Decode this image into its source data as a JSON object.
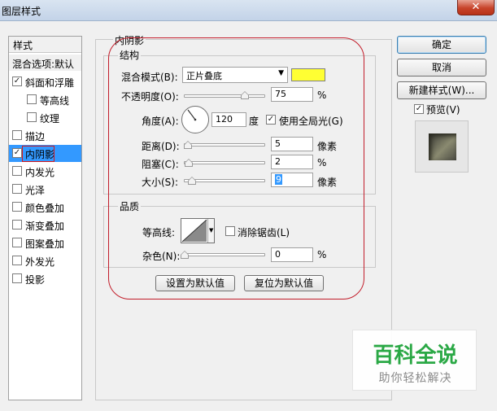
{
  "window": {
    "title": "图层样式",
    "close_glyph": "✕"
  },
  "style_list": {
    "header": "样式",
    "blend_options": "混合选项:默认",
    "items": [
      {
        "label": "斜面和浮雕",
        "checked": true
      },
      {
        "label": "等高线",
        "checked": false
      },
      {
        "label": "纹理",
        "checked": false
      },
      {
        "label": "描边",
        "checked": false
      },
      {
        "label": "内阴影",
        "checked": true,
        "selected": true
      },
      {
        "label": "内发光",
        "checked": false
      },
      {
        "label": "光泽",
        "checked": false
      },
      {
        "label": "颜色叠加",
        "checked": false
      },
      {
        "label": "渐变叠加",
        "checked": false
      },
      {
        "label": "图案叠加",
        "checked": false
      },
      {
        "label": "外发光",
        "checked": false
      },
      {
        "label": "投影",
        "checked": false
      }
    ]
  },
  "panel": {
    "title": "内阴影",
    "structure": {
      "title": "结构",
      "blend_mode_label": "混合模式(B):",
      "blend_mode_value": "正片叠底",
      "shadow_color": "#ffff33",
      "opacity_label": "不透明度(O):",
      "opacity_value": "75",
      "opacity_unit": "%",
      "opacity_fraction": 0.75,
      "angle_label": "角度(A):",
      "angle_value": "120",
      "angle_unit": "度",
      "use_global_light_label": "使用全局光(G)",
      "use_global_light_checked": true,
      "distance_label": "距离(D):",
      "distance_value": "5",
      "distance_unit": "像素",
      "choke_label": "阻塞(C):",
      "choke_value": "2",
      "choke_unit": "%",
      "size_label": "大小(S):",
      "size_value": "9",
      "size_unit": "像素"
    },
    "quality": {
      "title": "品质",
      "contour_label": "等高线:",
      "anti_alias_label": "消除锯齿(L)",
      "anti_alias_checked": false,
      "noise_label": "杂色(N):",
      "noise_value": "0",
      "noise_unit": "%"
    },
    "set_default_button": "设置为默认值",
    "reset_default_button": "复位为默认值"
  },
  "buttons": {
    "ok": "确定",
    "cancel": "取消",
    "new_style": "新建样式(W)...",
    "preview_label": "预览(V)",
    "preview_checked": true
  },
  "watermark": {
    "title": "百科全说",
    "subtitle": "助你轻松解决"
  },
  "colors": {
    "selected_row": "#3399ff",
    "annotation_red": "#c21d2a",
    "watermark_green": "#2aa845"
  }
}
